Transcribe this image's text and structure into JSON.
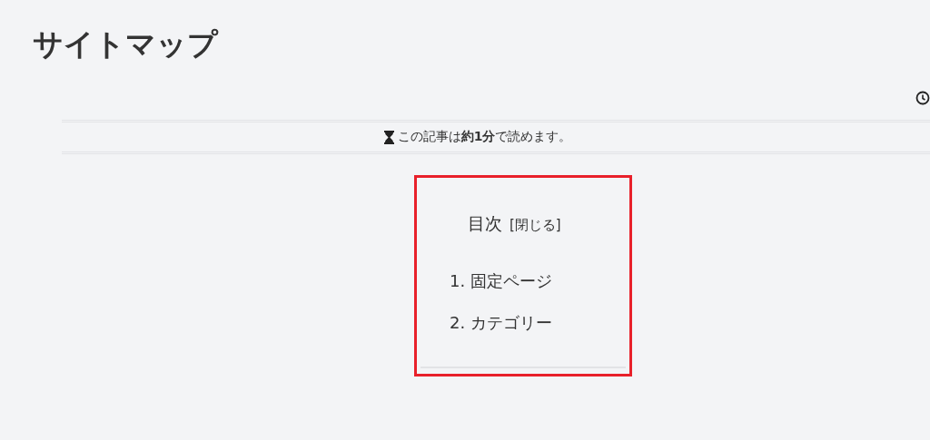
{
  "page_title": "サイトマップ",
  "reading_time": "この記事は**約1分**で読めます。",
  "toc": {
    "title": "目次",
    "toggle": "[閉じる]",
    "items": [
      {
        "number": "1.",
        "label": "固定ページ"
      },
      {
        "number": "2.",
        "label": "カテゴリー"
      }
    ]
  }
}
